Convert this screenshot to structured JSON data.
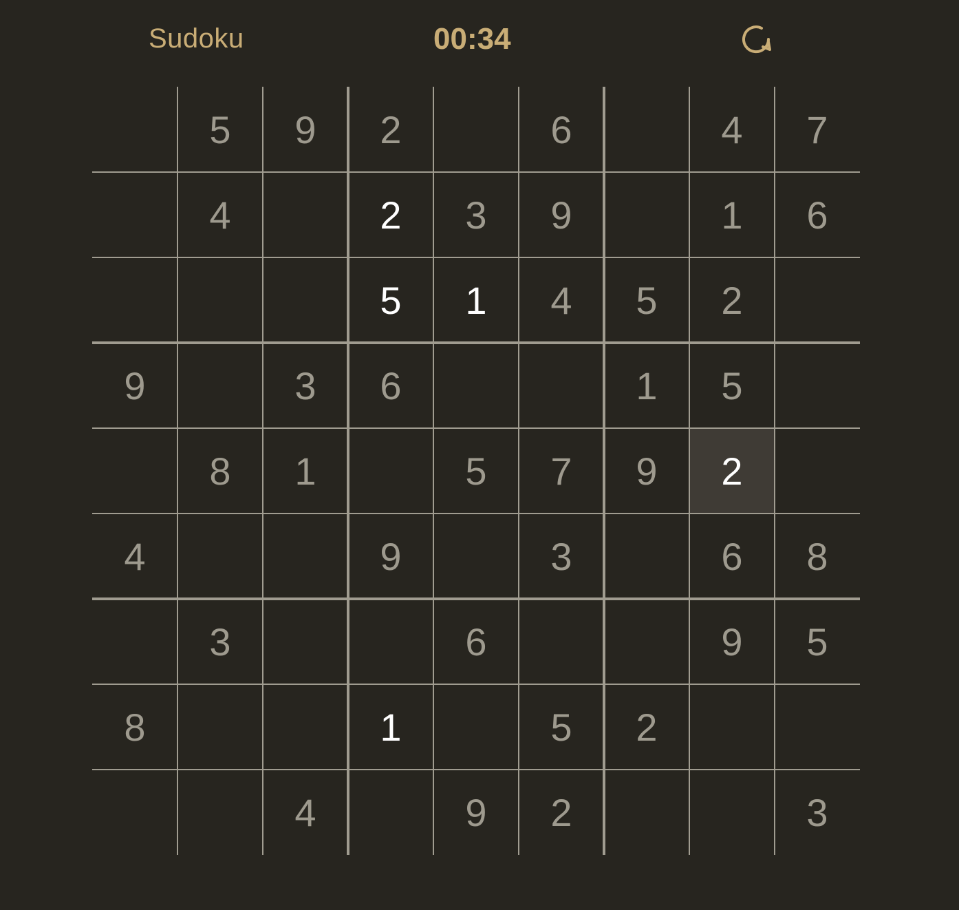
{
  "header": {
    "title": "Sudoku",
    "timer": "00:34",
    "restart_icon": "restart-icon"
  },
  "colors": {
    "background": "#27251f",
    "accent": "#c9ad76",
    "given_digit": "#9e9a8e",
    "entered_digit": "#ffffff",
    "selected_cell": "#3f3b35",
    "grid_line": "#a09c90"
  },
  "board": {
    "rows": [
      [
        "",
        "5",
        "9",
        "2",
        "",
        "6",
        "",
        "4",
        "7"
      ],
      [
        "",
        "4",
        "",
        "2",
        "3",
        "9",
        "",
        "1",
        "6"
      ],
      [
        "",
        "",
        "",
        "5",
        "1",
        "4",
        "5",
        "2",
        ""
      ],
      [
        "9",
        "",
        "3",
        "6",
        "",
        "",
        "1",
        "5",
        ""
      ],
      [
        "",
        "8",
        "1",
        "",
        "5",
        "7",
        "9",
        "2",
        ""
      ],
      [
        "4",
        "",
        "",
        "9",
        "",
        "3",
        "",
        "6",
        "8"
      ],
      [
        "",
        "3",
        "",
        "",
        "6",
        "",
        "",
        "9",
        "5"
      ],
      [
        "8",
        "",
        "",
        "1",
        "",
        "5",
        "2",
        "",
        ""
      ],
      [
        "",
        "",
        "4",
        "",
        "9",
        "2",
        "",
        "",
        "3"
      ]
    ],
    "entered_cells": [
      [
        1,
        3
      ],
      [
        2,
        3
      ],
      [
        2,
        4
      ],
      [
        4,
        7
      ],
      [
        7,
        3
      ]
    ],
    "selected_cell": [
      4,
      7
    ]
  }
}
